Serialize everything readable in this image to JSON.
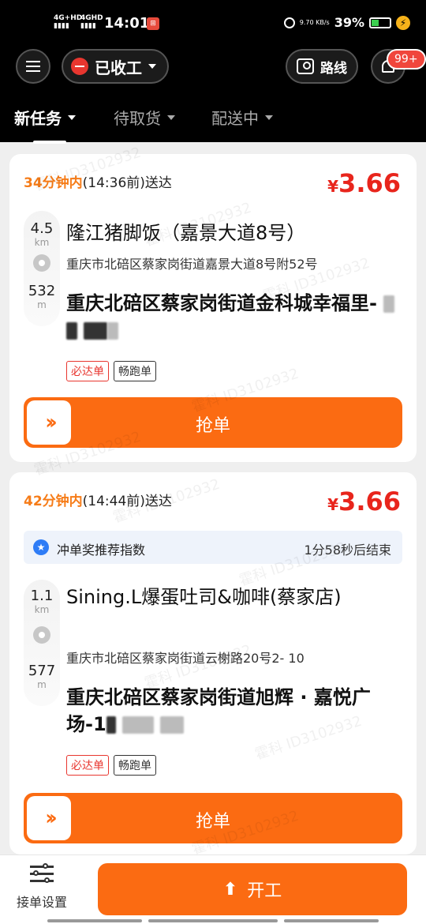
{
  "status_bar": {
    "network1": "4G+HD",
    "network2": "4GHD",
    "time": "14:01",
    "speed": "9.70 KB/s",
    "battery": "39%"
  },
  "header": {
    "status_label": "已收工",
    "route_label": "路线",
    "notification_badge": "99+"
  },
  "tabs": [
    {
      "label": "新任务"
    },
    {
      "label": "待取货"
    },
    {
      "label": "配送中"
    }
  ],
  "orders": [
    {
      "time_minutes": "34分钟内",
      "time_rest": "(14:36前)送达",
      "currency": "¥",
      "price": "3.66",
      "pickup_distance": "4.5",
      "pickup_unit": "km",
      "drop_distance": "532",
      "drop_unit": "m",
      "shop_name": "隆江猪脚饭（嘉景大道8号）",
      "shop_address": "重庆市北碚区蔡家岗街道嘉景大道8号附52号",
      "destination": "重庆北碚区蔡家岗街道金科城幸福里-",
      "tags": [
        "必达单",
        "畅跑单"
      ],
      "grab_label": "抢单"
    },
    {
      "time_minutes": "42分钟内",
      "time_rest": "(14:44前)送达",
      "currency": "¥",
      "price": "3.66",
      "bonus_text": "冲单奖推荐指数",
      "bonus_timer": "1分58秒后结束",
      "pickup_distance": "1.1",
      "pickup_unit": "km",
      "drop_distance": "577",
      "drop_unit": "m",
      "shop_name": "Sining.L爆蛋吐司&咖啡(蔡家店)",
      "shop_address": "重庆市北碚区蔡家岗街道云榭路20号2- 10",
      "destination": "重庆北碚区蔡家岗街道旭辉 · 嘉悦广场-1",
      "tags": [
        "必达单",
        "畅跑单"
      ],
      "grab_label": "抢单"
    }
  ],
  "bottom": {
    "settings_label": "接单设置",
    "start_label": "开工"
  },
  "watermark": "霍科 ID3102932",
  "colors": {
    "accent": "#fb6b12",
    "price": "#e8251c",
    "badge": "#f0463c"
  }
}
